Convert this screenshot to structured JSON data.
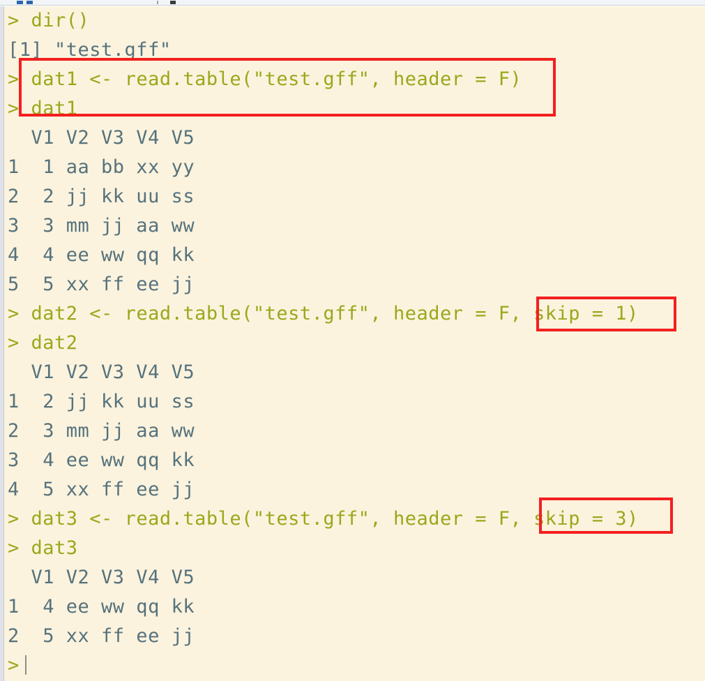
{
  "window": {
    "app": "R Console",
    "toolbar_icons": [
      "new-doc-icon",
      "open-folder-icon",
      "separator-icon",
      "print-icon"
    ]
  },
  "console": {
    "prompt_symbol": ">",
    "colors": {
      "background": "#fbf3de",
      "command_text": "#9aa81b",
      "output_text": "#56727c",
      "annotation": "#f32020",
      "gutter": "#dfe3e8",
      "toolbar": "#f2f5f7"
    },
    "lines": [
      {
        "type": "command",
        "prompt": ">",
        "text": " dir()"
      },
      {
        "type": "output",
        "prompt": "",
        "text": "[1] \"test.gff\""
      },
      {
        "type": "command",
        "prompt": ">",
        "text": " dat1 <- read.table(\"test.gff\", header = F)"
      },
      {
        "type": "command",
        "prompt": ">",
        "text": " dat1"
      },
      {
        "type": "output",
        "prompt": "",
        "text": "  V1 V2 V3 V4 V5"
      },
      {
        "type": "output",
        "prompt": "",
        "text": "1  1 aa bb xx yy"
      },
      {
        "type": "output",
        "prompt": "",
        "text": "2  2 jj kk uu ss"
      },
      {
        "type": "output",
        "prompt": "",
        "text": "3  3 mm jj aa ww"
      },
      {
        "type": "output",
        "prompt": "",
        "text": "4  4 ee ww qq kk"
      },
      {
        "type": "output",
        "prompt": "",
        "text": "5  5 xx ff ee jj"
      },
      {
        "type": "command",
        "prompt": ">",
        "text": " dat2 <- read.table(\"test.gff\", header = F, skip = 1)"
      },
      {
        "type": "command",
        "prompt": ">",
        "text": " dat2"
      },
      {
        "type": "output",
        "prompt": "",
        "text": "  V1 V2 V3 V4 V5"
      },
      {
        "type": "output",
        "prompt": "",
        "text": "1  2 jj kk uu ss"
      },
      {
        "type": "output",
        "prompt": "",
        "text": "2  3 mm jj aa ww"
      },
      {
        "type": "output",
        "prompt": "",
        "text": "3  4 ee ww qq kk"
      },
      {
        "type": "output",
        "prompt": "",
        "text": "4  5 xx ff ee jj"
      },
      {
        "type": "command",
        "prompt": ">",
        "text": " dat3 <- read.table(\"test.gff\", header = F, skip = 3)"
      },
      {
        "type": "command",
        "prompt": ">",
        "text": " dat3"
      },
      {
        "type": "output",
        "prompt": "",
        "text": "  V1 V2 V3 V4 V5"
      },
      {
        "type": "output",
        "prompt": "",
        "text": "1  4 ee ww qq kk"
      },
      {
        "type": "output",
        "prompt": "",
        "text": "2  5 xx ff ee jj"
      },
      {
        "type": "cursor",
        "prompt": ">",
        "text": ""
      }
    ]
  },
  "annotations": [
    {
      "id": "redbox-1",
      "label": "highlight-read-table-default",
      "covers": "dat1 <- read.table(\"test.gff\", header = F) / dat1"
    },
    {
      "id": "redbox-2",
      "label": "highlight-skip-1",
      "covers": " skip = 1)"
    },
    {
      "id": "redbox-3",
      "label": "highlight-skip-3",
      "covers": " skip = 3)"
    }
  ]
}
